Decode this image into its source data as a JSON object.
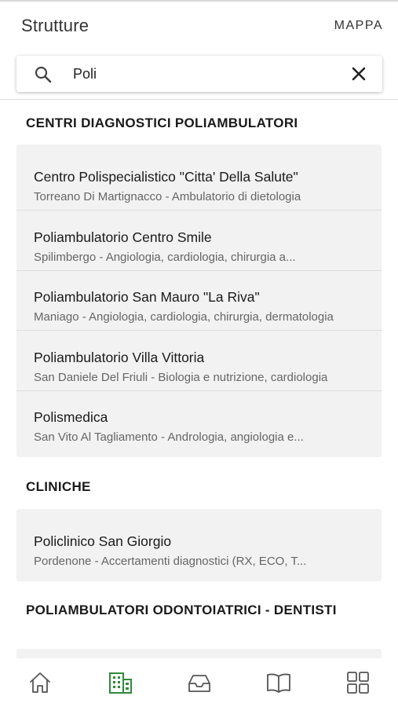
{
  "header": {
    "title": "Strutture",
    "map_label": "MAPPA"
  },
  "search": {
    "value": "Poli"
  },
  "sections": [
    {
      "title": "CENTRI DIAGNOSTICI POLIAMBULATORI",
      "items": [
        {
          "name": "Centro Polispecialistico \"Citta' Della Salute\"",
          "desc": "Torreano Di Martignacco - Ambulatorio di dietologia"
        },
        {
          "name": "Poliambulatorio Centro Smile",
          "desc": "Spilimbergo - Angiologia, cardiologia, chirurgia a..."
        },
        {
          "name": "Poliambulatorio San Mauro \"La Riva\"",
          "desc": "Maniago - Angiologia, cardiologia, chirurgia, dermatologia"
        },
        {
          "name": "Poliambulatorio Villa Vittoria",
          "desc": "San Daniele Del Friuli - Biologia e nutrizione, cardiologia"
        },
        {
          "name": "Polismedica",
          "desc": "San Vito Al Tagliamento - Andrologia, angiologia e..."
        }
      ]
    },
    {
      "title": "CLINICHE",
      "items": [
        {
          "name": "Policlinico San Giorgio",
          "desc": "Pordenone - Accertamenti diagnostici (RX, ECO, T..."
        }
      ]
    },
    {
      "title": "POLIAMBULATORI ODONTOIATRICI - DENTISTI",
      "items": []
    }
  ],
  "bottom_nav": [
    {
      "icon": "home-icon",
      "active": false
    },
    {
      "icon": "buildings-icon",
      "active": true
    },
    {
      "icon": "inbox-icon",
      "active": false
    },
    {
      "icon": "book-icon",
      "active": false
    },
    {
      "icon": "grid-icon",
      "active": false
    }
  ],
  "colors": {
    "accent": "#2e8b3a",
    "icon": "#555555",
    "card_bg": "#f2f2f2"
  }
}
